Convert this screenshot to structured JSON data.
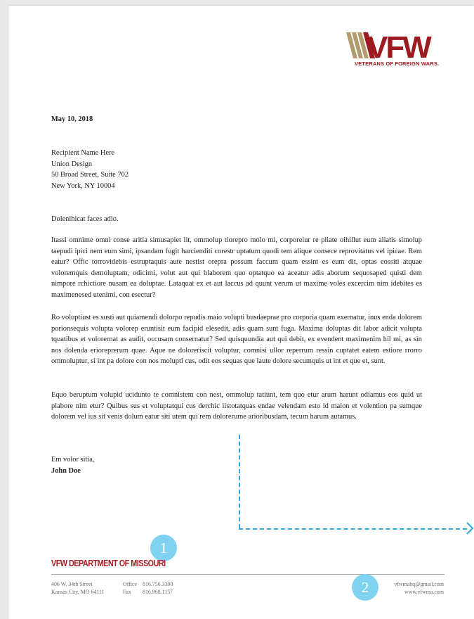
{
  "logo": {
    "mark_text": "VFW",
    "tagline": "VETERANS OF FOREIGN WARS.",
    "brand_color": "#9b1b20",
    "accent_color": "#b39b6c"
  },
  "letter": {
    "date": "May 10, 2018",
    "recipient": [
      "Recipient Name Here",
      "Union Design",
      "50 Broad Street, Suite 702",
      "New York, NY 10004"
    ],
    "salutation": "Dolenihicat faces adio.",
    "paragraphs": [
      "Itassi omnime omni conse aritia simusapiet lit, ommolup tiorepro molo mi, corporeiur re pliate oihillut eum aliatis simolup taepudi ipici nem eum simi, ipsandam fugit harcienditi corestr uptatum quodi tem alique consece reprovitatus vel ipicae. Rem eatur? Offic torrovidebis estruptaquis aute nestist orepra possum faccum quam essint es eum dit, optas eossiti atquae voloremquis demoluptam, odicimi, volut aut qui blaborem quo optatquo ea aceatur adis aborum sequosaped quisti dem nimpore rchictiore nusam ea doluptae. Lataquat ex et aut laccus ad quunt verum ut maxime voles excercim nim idebites es maximenesed utenimi, con esectur?",
      "Ro voluptiust es susti aut quiamendi dolorpo repudis maio volupti busdaeprae pro corporia quam exernatur, inus enda dolorem porionsequis volupta volorep eruntisit eum facipid elesedit, adis quam sunt fuga. Maxima doluptas dit labor adicit volupta tquatibus et volorernat as audit, occusam consernatur? Sed quisquundia aut qui debit, ex evendent maximenim hil mi, as sin nos dolenda erioreprerum quae. Aque ne doloreriscit voluptur, comnisi ullor reperrum ressin cuptatet eatem estiore rrorro ommoluptur, si int pa dolore con nos molupti cus, odit eos sequas que laute dolore secumquis ut int et que et, sunt.",
      "Equo beruptum volupid uciduntο te comnistem con nest, ommolup tatiunt, tem quo etur arum harunt odiamus eos quid ut plabore nim etur? Quibus sus et voluptatqui cus derchic iistotatquas endae velendam esto id maion et volention pa sumque dolorem vel ius sit venis dolum eatur siti utem qui rem dolorerume arioribusdam, tecum harum autamus."
    ],
    "closing": "Em volor sitia,",
    "signer": "John Doe"
  },
  "markers": [
    "1",
    "2"
  ],
  "footer": {
    "department": "VFW DEPARTMENT OF MISSOURI",
    "street": "406 W. 34th Street",
    "city": "Kansas City, MO 64111",
    "office_label": "Office",
    "office_number": "816.756.3390",
    "fax_label": "Fax",
    "fax_number": "816.968.1157",
    "email": "vfwmahq@gmail.com",
    "website": "www.vfwma.com"
  },
  "annotation_color": "#29a9df"
}
